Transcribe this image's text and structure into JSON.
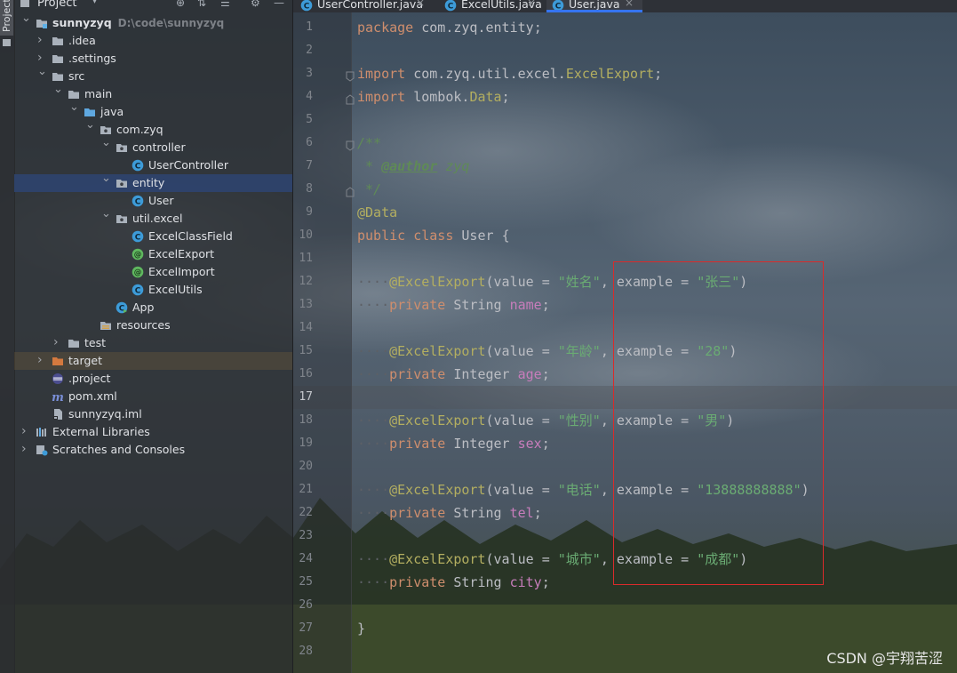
{
  "sidebar": {
    "vertical_tab": "Project",
    "panel_title": "Project"
  },
  "tree": [
    {
      "label": "sunnyzyq",
      "hint": "D:\\code\\sunnyzyq",
      "icon": "module-folder-icon",
      "arrow": "down"
    },
    {
      "label": ".idea",
      "icon": "folder-icon",
      "arrow": "right"
    },
    {
      "label": ".settings",
      "icon": "folder-icon",
      "arrow": "right"
    },
    {
      "label": "src",
      "icon": "folder-icon",
      "arrow": "down"
    },
    {
      "label": "main",
      "icon": "folder-icon",
      "arrow": "down"
    },
    {
      "label": "java",
      "icon": "source-folder-icon",
      "arrow": "down"
    },
    {
      "label": "com.zyq",
      "icon": "package-icon",
      "arrow": "down"
    },
    {
      "label": "controller",
      "icon": "package-icon",
      "arrow": "down"
    },
    {
      "label": "UserController",
      "icon": "java-class-icon",
      "arrow": ""
    },
    {
      "label": "entity",
      "icon": "package-icon",
      "arrow": "down"
    },
    {
      "label": "User",
      "icon": "java-class-icon",
      "arrow": ""
    },
    {
      "label": "util.excel",
      "icon": "package-icon",
      "arrow": "down"
    },
    {
      "label": "ExcelClassField",
      "icon": "java-class-icon",
      "arrow": ""
    },
    {
      "label": "ExcelExport",
      "icon": "annotation-icon",
      "arrow": ""
    },
    {
      "label": "ExcelImport",
      "icon": "annotation-icon",
      "arrow": ""
    },
    {
      "label": "ExcelUtils",
      "icon": "java-class-icon",
      "arrow": ""
    },
    {
      "label": "App",
      "icon": "java-main-class-icon",
      "arrow": ""
    },
    {
      "label": "resources",
      "icon": "resources-folder-icon",
      "arrow": ""
    },
    {
      "label": "test",
      "icon": "folder-icon",
      "arrow": "right"
    },
    {
      "label": "target",
      "icon": "excluded-folder-icon",
      "arrow": "right"
    },
    {
      "label": ".project",
      "icon": "eclipse-file-icon",
      "arrow": ""
    },
    {
      "label": "pom.xml",
      "icon": "maven-icon",
      "arrow": ""
    },
    {
      "label": "sunnyzyq.iml",
      "icon": "iml-file-icon",
      "arrow": ""
    },
    {
      "label": "External Libraries",
      "icon": "libraries-icon",
      "arrow": "right"
    },
    {
      "label": "Scratches and Consoles",
      "icon": "scratches-icon",
      "arrow": "right"
    }
  ],
  "tabs": [
    {
      "label": "UserController.java",
      "icon": "java-class-icon"
    },
    {
      "label": "ExcelUtils.java",
      "icon": "java-class-icon"
    },
    {
      "label": "User.java",
      "icon": "java-class-icon",
      "active": true
    }
  ],
  "editor": {
    "current_line": 17,
    "line_numbers": [
      "1",
      "2",
      "3",
      "4",
      "5",
      "6",
      "7",
      "8",
      "9",
      "10",
      "11",
      "12",
      "13",
      "14",
      "15",
      "16",
      "17",
      "18",
      "19",
      "20",
      "21",
      "22",
      "23",
      "24",
      "25",
      "26",
      "27",
      "28"
    ],
    "code": {
      "package_kw": "package",
      "package_name": "com.zyq.entity",
      "semicolon": ";",
      "import_kw": "import",
      "import1_pkg": "com.zyq.util.excel.",
      "import1_cls": "ExcelExport",
      "import2_pkg": "lombok.",
      "import2_cls": "Data",
      "doc_open": "/**",
      "doc_star": " * ",
      "doc_tag": "@author",
      "doc_author": " zyq",
      "doc_close": " */",
      "data_ann": "@Data",
      "public_kw": "public",
      "class_kw": "class",
      "class_name": "User",
      "brace_open": "{",
      "brace_close": "}",
      "indent": "····",
      "private_kw": "private",
      "ann_name": "@ExcelExport",
      "ann_value_part": "(value = ",
      "comma": ", ",
      "example_part": "example = ",
      "paren_close": ")",
      "fields": [
        {
          "value": "\"姓名\"",
          "example": "\"张三\"",
          "type": "String",
          "name": "name"
        },
        {
          "value": "\"年龄\"",
          "example": "\"28\"",
          "type": "Integer",
          "name": "age"
        },
        {
          "value": "\"性别\"",
          "example": "\"男\"",
          "type": "Integer",
          "name": "sex"
        },
        {
          "value": "\"电话\"",
          "example": "\"13888888888\"",
          "type": "String",
          "name": "tel"
        },
        {
          "value": "\"城市\"",
          "example": "\"成都\"",
          "type": "String",
          "name": "city"
        }
      ]
    }
  },
  "watermark": "CSDN @宇翔苦涩",
  "colors": {
    "keyword": "#cf8e6d",
    "annotation": "#b3ae60",
    "string": "#6aab73",
    "field": "#c77dbb",
    "comment": "#5f8a56",
    "highlight_box": "#d92b2b",
    "selection": "#2e436e"
  }
}
